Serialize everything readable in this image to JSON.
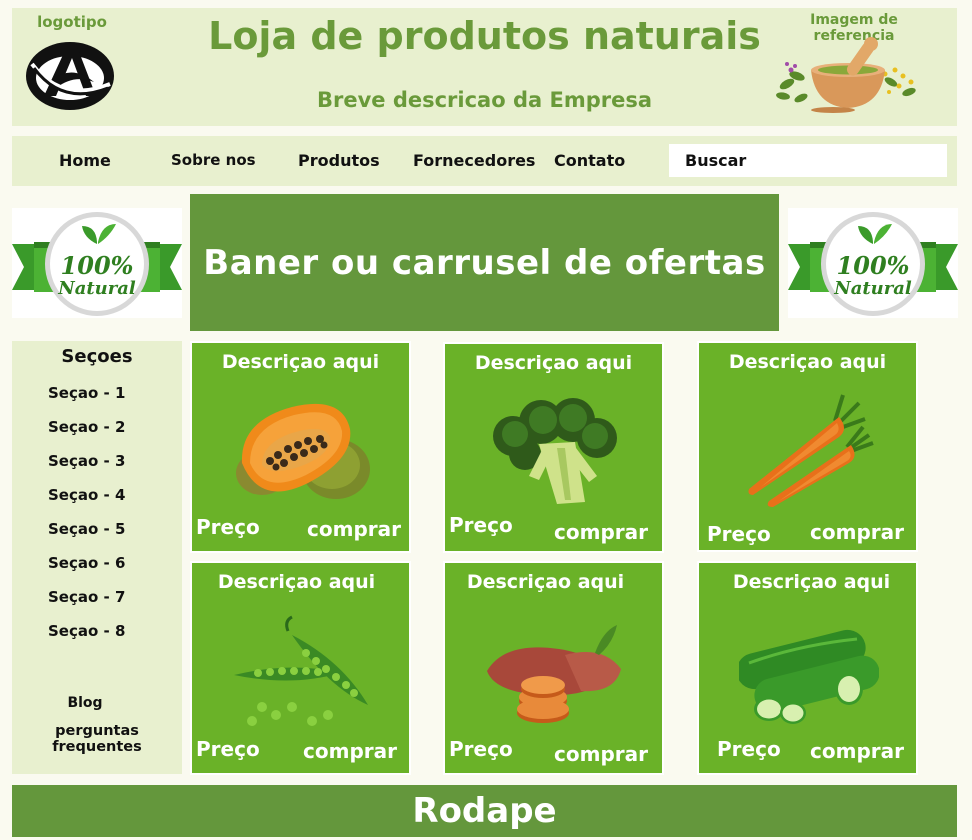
{
  "header": {
    "logo_label": "logotipo",
    "title": "Loja de produtos naturais",
    "description": "Breve descricao da Empresa",
    "reference_label": "Imagem de referencia",
    "reference_icon": "mortar-herbs-icon"
  },
  "nav": {
    "items": [
      "Home",
      "Sobre nos",
      "Produtos",
      "Fornecedores",
      "Contato"
    ],
    "search_placeholder": "Buscar"
  },
  "badges": {
    "top": "100%",
    "bottom": "Natural"
  },
  "banner": {
    "text": "Baner ou carrusel de ofertas"
  },
  "sidebar": {
    "title": "Seçoes",
    "items": [
      "Seçao - 1",
      "Seçao - 2",
      "Seçao - 3",
      "Seçao - 4",
      "Seçao - 5",
      "Seçao - 6",
      "Seçao - 7",
      "Seçao - 8"
    ],
    "blog": "Blog",
    "faq": "perguntas frequentes"
  },
  "products": [
    {
      "description": "Descriçao aqui",
      "price_label": "Preço",
      "buy_label": "comprar",
      "icon": "papaya-icon"
    },
    {
      "description": "Descriçao aqui",
      "price_label": "Preço",
      "buy_label": "comprar",
      "icon": "broccoli-icon"
    },
    {
      "description": "Descriçao aqui",
      "price_label": "Preço",
      "buy_label": "comprar",
      "icon": "carrot-icon"
    },
    {
      "description": "Descriçao aqui",
      "price_label": "Preço",
      "buy_label": "comprar",
      "icon": "peas-icon"
    },
    {
      "description": "Descriçao aqui",
      "price_label": "Preço",
      "buy_label": "comprar",
      "icon": "sweet-potato-icon"
    },
    {
      "description": "Descriçao aqui",
      "price_label": "Preço",
      "buy_label": "comprar",
      "icon": "cucumber-icon"
    }
  ],
  "footer": {
    "text": "Rodape"
  },
  "colors": {
    "light_panel": "#e8f0cf",
    "banner_green": "#64973c",
    "card_green": "#6ab228",
    "title_green": "#6a9a3a"
  }
}
